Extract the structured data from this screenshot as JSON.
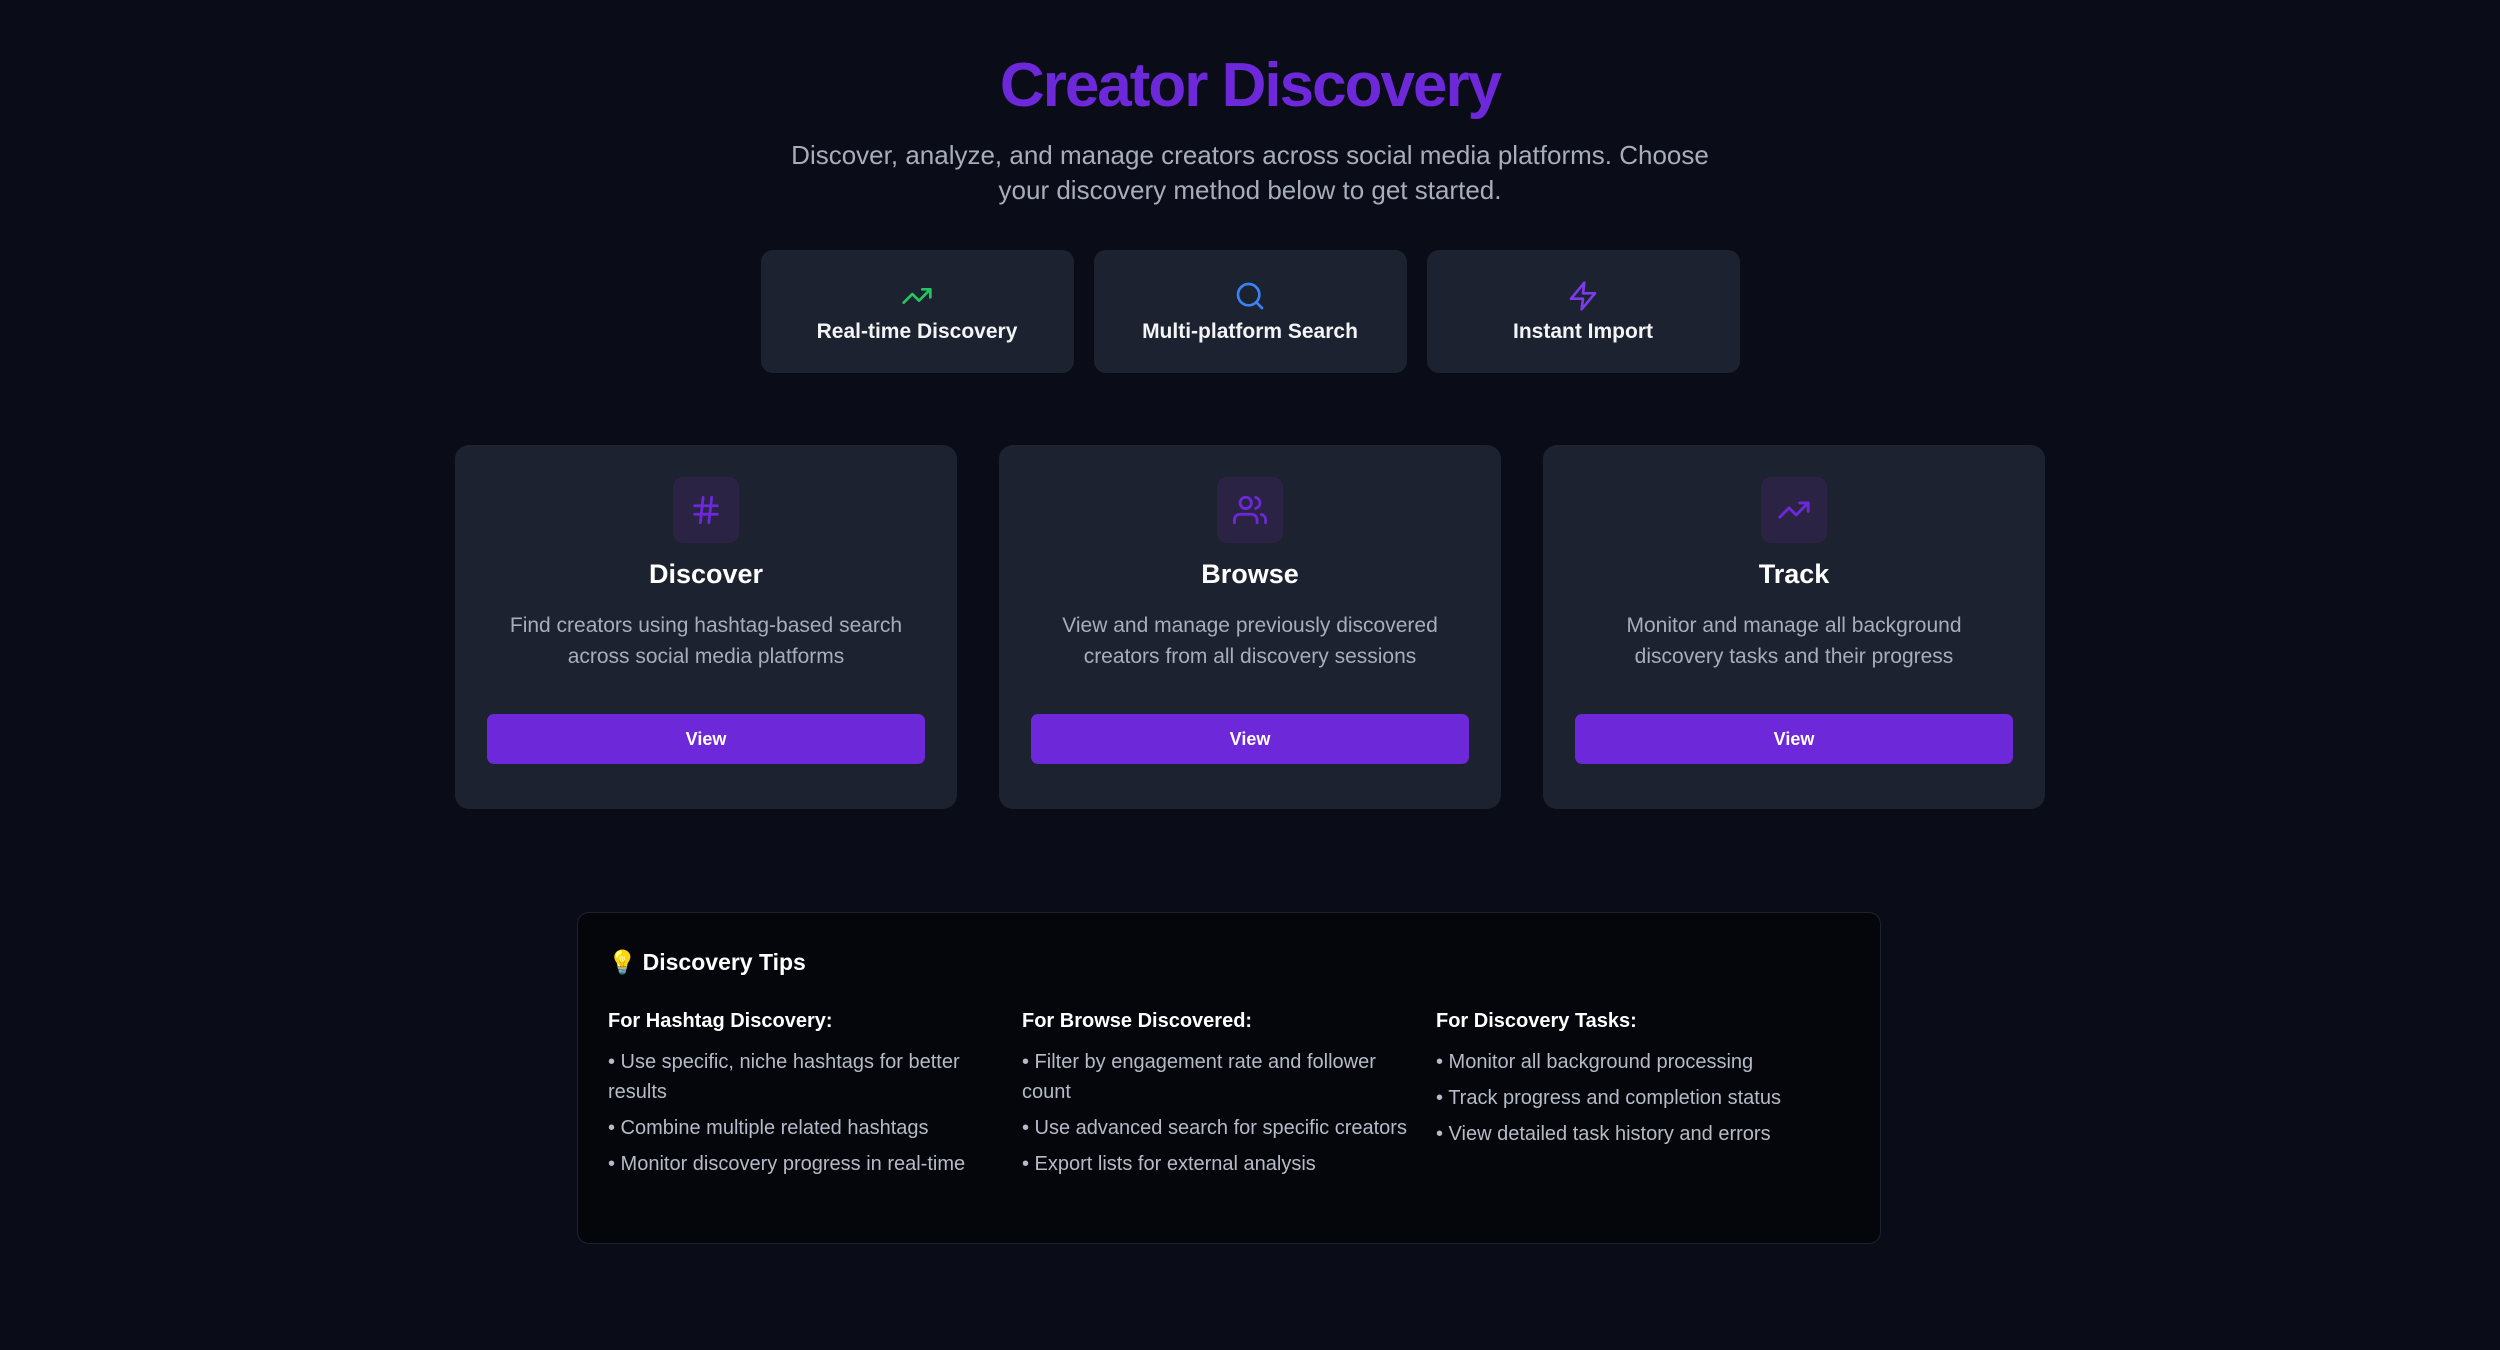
{
  "header": {
    "title": "Creator Discovery",
    "subtitle": "Discover, analyze, and manage creators across social media platforms. Choose your discovery method below to get started."
  },
  "features": [
    {
      "label": "Real-time Discovery",
      "icon": "trending-up-icon",
      "color": "#22c55e"
    },
    {
      "label": "Multi-platform Search",
      "icon": "search-icon",
      "color": "#3b82f6"
    },
    {
      "label": "Instant Import",
      "icon": "zap-icon",
      "color": "#7c3aed"
    }
  ],
  "cards": [
    {
      "title": "Discover",
      "description": "Find creators using hashtag-based search across social media platforms",
      "button": "View",
      "icon": "hashtag-icon"
    },
    {
      "title": "Browse",
      "description": "View and manage previously discovered creators from all discovery sessions",
      "button": "View",
      "icon": "users-icon"
    },
    {
      "title": "Track",
      "description": "Monitor and manage all background discovery tasks and their progress",
      "button": "View",
      "icon": "trending-up-icon"
    }
  ],
  "tips": {
    "heading": "Discovery Tips",
    "bulb": "💡",
    "columns": [
      {
        "title": "For Hashtag Discovery:",
        "items": [
          "• Use specific, niche hashtags for better results",
          "• Combine multiple related hashtags",
          "• Monitor discovery progress in real-time"
        ]
      },
      {
        "title": "For Browse Discovered:",
        "items": [
          "• Filter by engagement rate and follower count",
          "• Use advanced search for specific creators",
          "• Export lists for external analysis"
        ]
      },
      {
        "title": "For Discovery Tasks:",
        "items": [
          "• Monitor all background processing",
          "• Track progress and completion status",
          "• View detailed task history and errors"
        ]
      }
    ]
  },
  "colors": {
    "accent": "#6d28d9",
    "background": "#0a0d17",
    "card": "#1c222f"
  }
}
